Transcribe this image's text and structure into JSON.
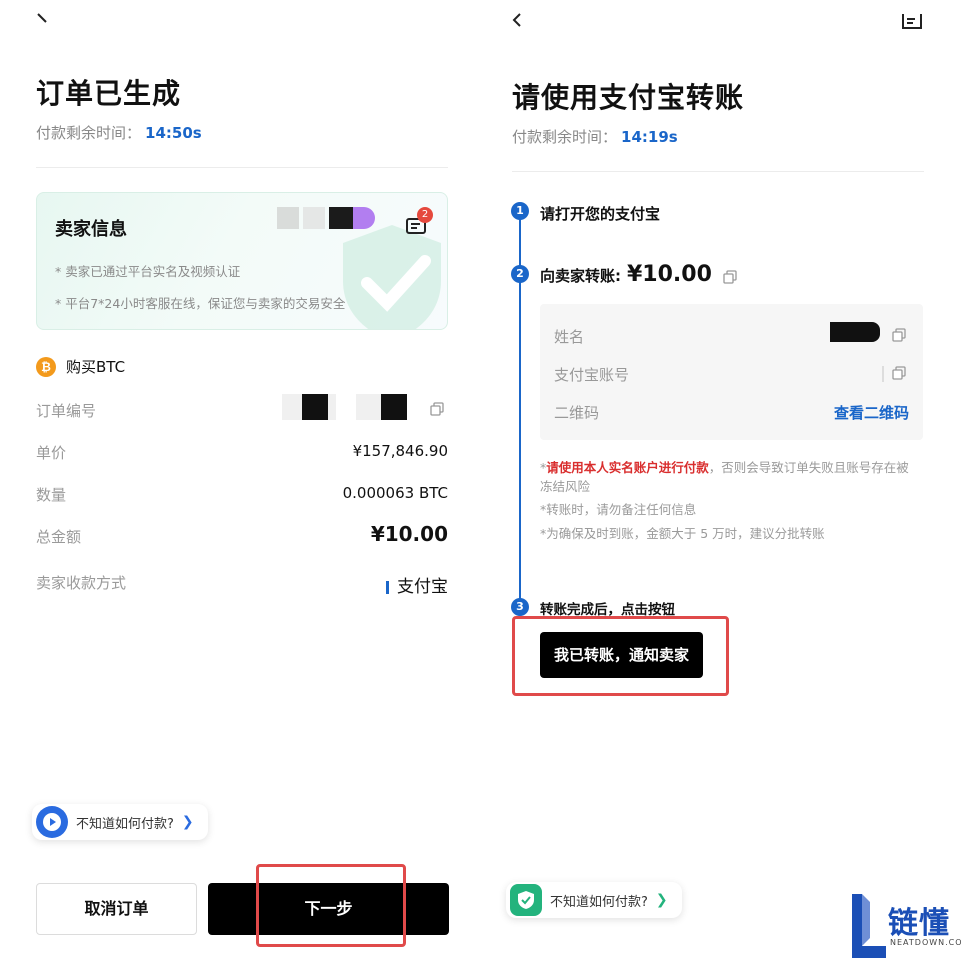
{
  "left": {
    "title": "订单已生成",
    "countdown_label": "付款剩余时间：",
    "countdown_value": "14:50s",
    "seller_card": {
      "title": "卖家信息",
      "badge_count": "2",
      "notes": [
        "* 卖家已通过平台实名及视频认证",
        "* 平台7*24小时客服在线，保证您与卖家的交易安全"
      ]
    },
    "buy_label": "购买BTC",
    "btc_symbol": "₿",
    "rows": [
      {
        "key": "订单编号",
        "value": ""
      },
      {
        "key": "单价",
        "value": "¥157,846.90"
      },
      {
        "key": "数量",
        "value": "0.000063 BTC"
      },
      {
        "key": "总金额",
        "value": "¥10.00"
      },
      {
        "key": "卖家收款方式",
        "value": "支付宝"
      }
    ],
    "help_text": "不知道如何付款?",
    "help_chevron": "❯",
    "cancel_label": "取消订单",
    "next_label": "下一步"
  },
  "right": {
    "title": "请使用支付宝转账",
    "countdown_label": "付款剩余时间：",
    "countdown_value": "14:19s",
    "steps": [
      {
        "num": "1",
        "text": "请打开您的支付宝"
      },
      {
        "num": "2",
        "text": "向卖家转账:",
        "amount": "¥10.00"
      },
      {
        "num": "3",
        "text": "转账完成后，点击按钮"
      }
    ],
    "details": [
      {
        "key": "姓名"
      },
      {
        "key": "支付宝账号"
      },
      {
        "key": "二维码",
        "link": "查看二维码"
      }
    ],
    "warning_red": "请使用本人实名账户进行付款",
    "warning_rest": "，否则会导致订单失败且账号存在被冻结风险",
    "warning_2": "*转账时，请勿备注任何信息",
    "warning_3": "*为确保及时到账，金额大于 5 万时，建议分批转账",
    "star": "*",
    "notify_label": "我已转账，通知卖家",
    "help_text": "不知道如何付款?",
    "help_chevron": "❯"
  },
  "logo": {
    "text": "链懂",
    "sub": "NEATDOWN.COM"
  },
  "colors": {
    "accent": "#1a66c9",
    "highlight_frame": "#e04a4a",
    "alert": "#d92e2e",
    "brand_green": "#23b37d"
  }
}
